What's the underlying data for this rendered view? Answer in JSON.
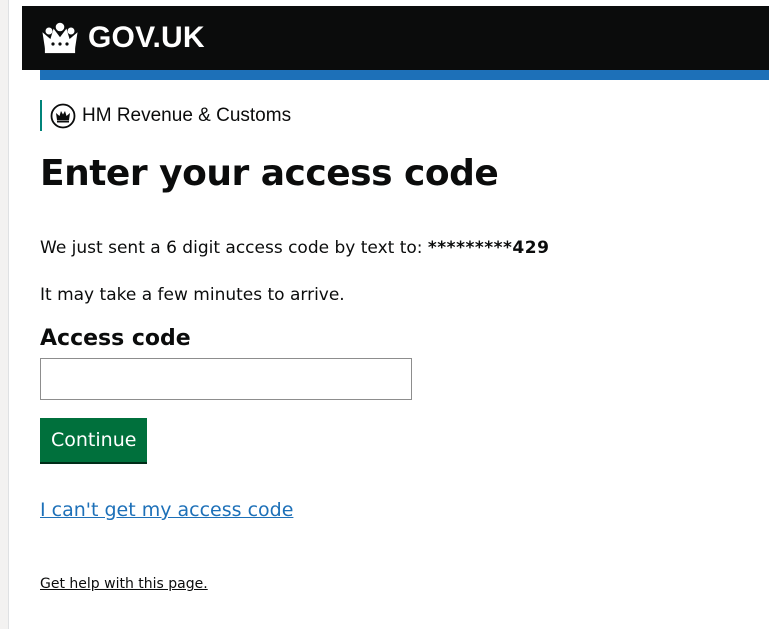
{
  "header": {
    "logo_text": "GOV.UK",
    "logo_icon": "crown-icon",
    "background_color": "#0b0c0c",
    "accent_bar_color": "#1d70b8"
  },
  "organisation": {
    "name": "HM Revenue & Customs",
    "crest_icon": "hmrc-crest-icon",
    "brand_color": "#00847a"
  },
  "main": {
    "title": "Enter your access code",
    "sent_message_prefix": "We just sent a 6 digit access code by text to: ",
    "masked_phone_number": "*********429",
    "arrival_message": "It may take a few minutes to arrive.",
    "access_code_label": "Access code",
    "access_code_value": "",
    "continue_label": "Continue",
    "continue_color": "#00703c",
    "cant_get_code_link": "I can't get my access code",
    "link_color": "#1d70b8"
  },
  "footer": {
    "help_link": "Get help with this page."
  }
}
